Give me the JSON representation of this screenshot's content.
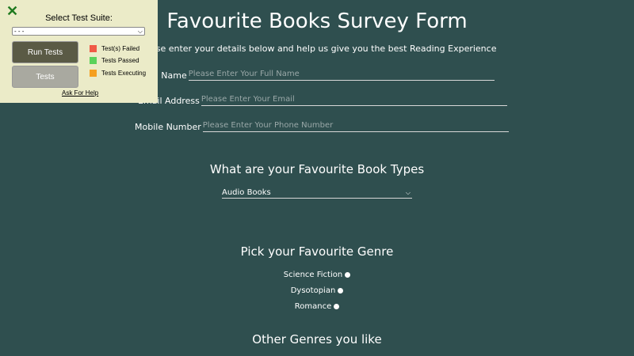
{
  "form": {
    "title": "Favourite Books Survey Form",
    "subtitle": "Please enter your details below and help us give you the best Reading Experience",
    "name_label": "Full Name",
    "name_placeholder": "Please Enter Your Full Name",
    "email_label": "Email Address",
    "email_placeholder": "Please Enter Your Email",
    "phone_label": "Mobile Number",
    "phone_placeholder": "Please Enter Your Phone Number",
    "types_heading": "What are your Favourite Book Types",
    "types_selected": "Audio Books",
    "genre_heading": "Pick your Favourite Genre",
    "genres": [
      "Science Fiction",
      "Dysotopian",
      "Romance"
    ],
    "other_heading": "Other Genres you like"
  },
  "panel": {
    "close_icon": "close-icon",
    "title": "Select Test Suite:",
    "suite_selected": "- - -",
    "run_label": "Run Tests",
    "tests_label": "Tests",
    "legend": [
      {
        "label": "Test(s) Failed",
        "color": "#f05a46"
      },
      {
        "label": "Tests Passed",
        "color": "#5ad25a"
      },
      {
        "label": "Tests Executing",
        "color": "#f5a020"
      }
    ],
    "help_label": "Ask For Help"
  }
}
